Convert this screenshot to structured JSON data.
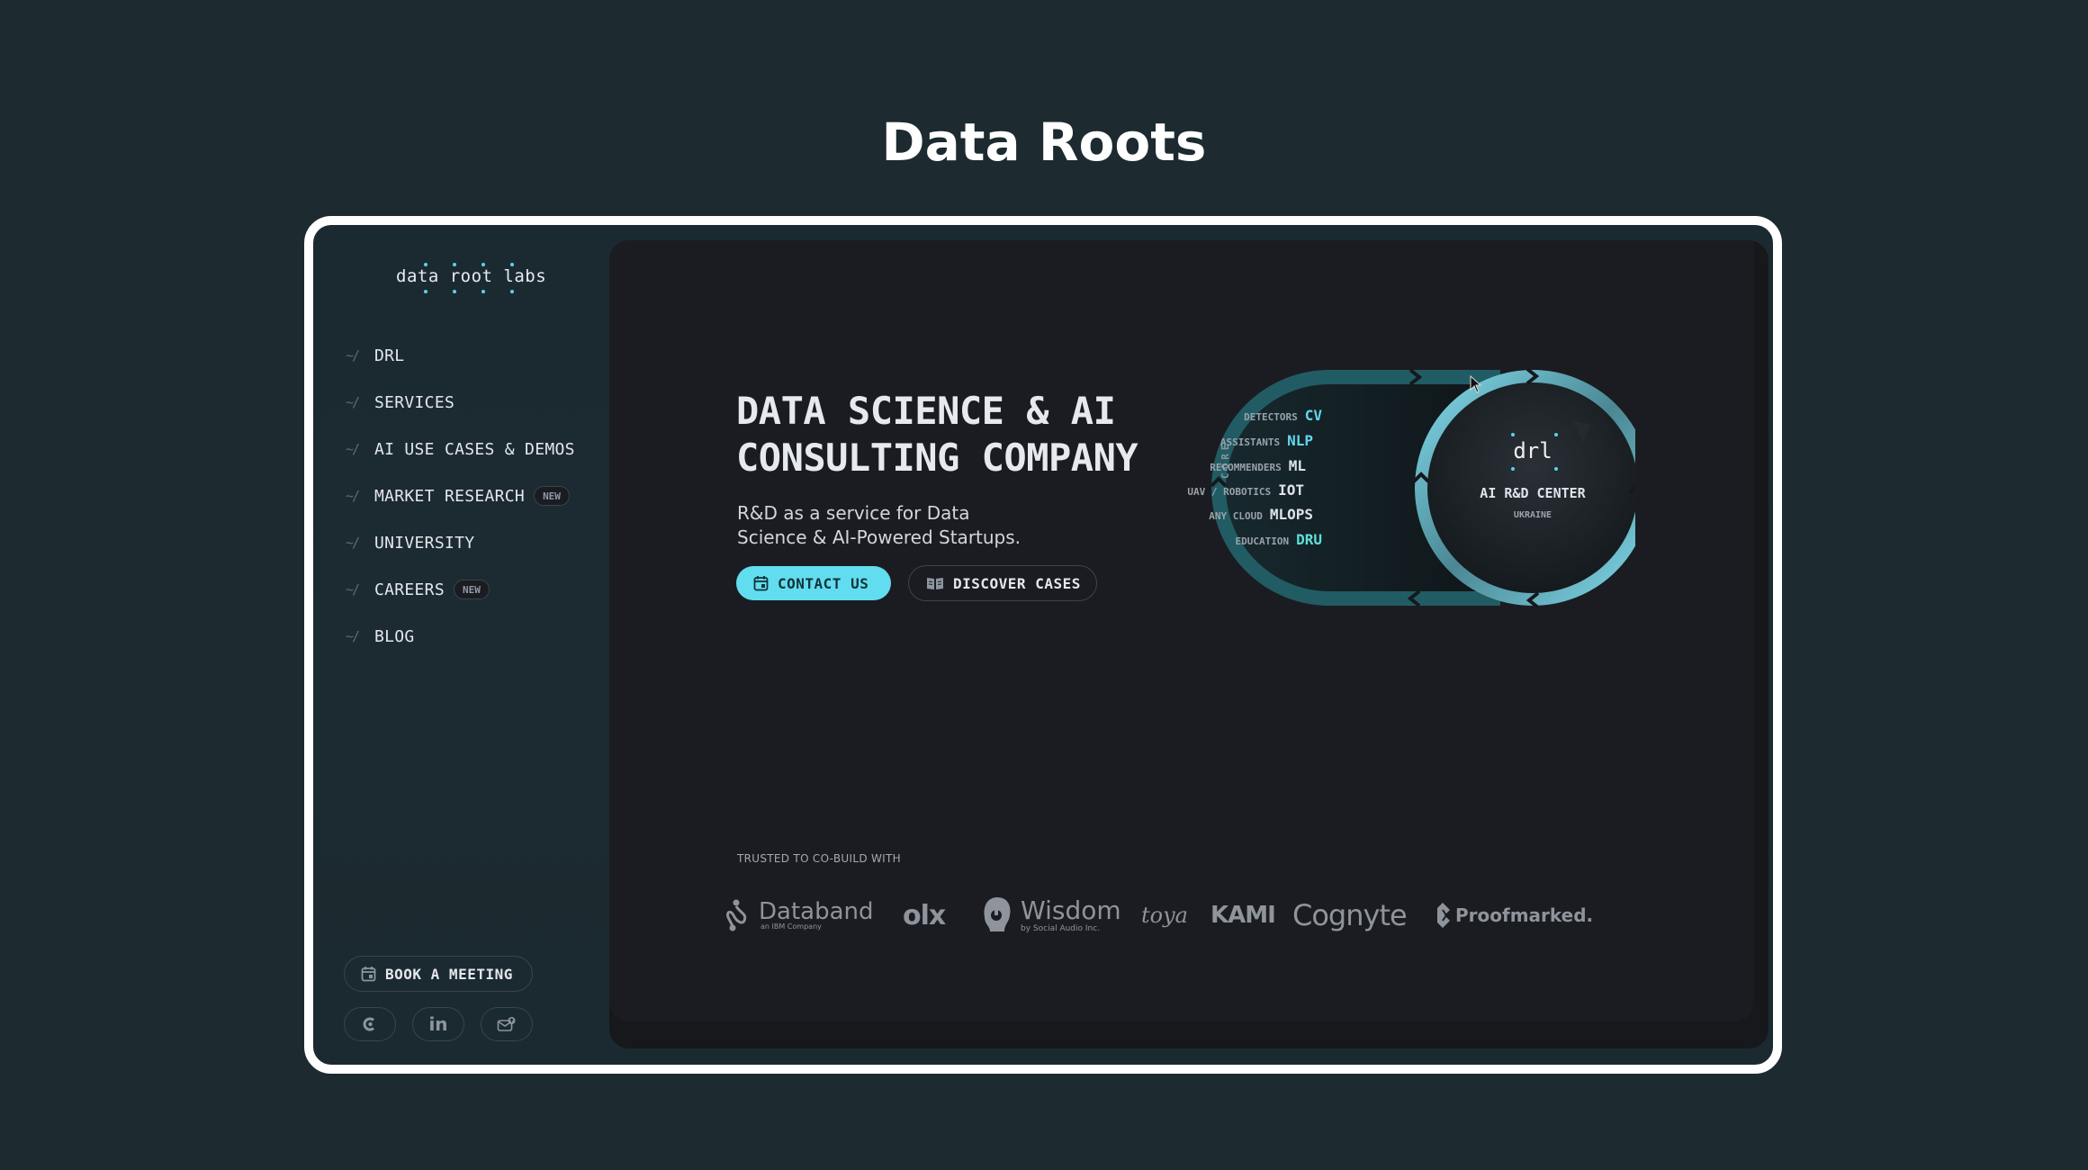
{
  "page": {
    "title": "Data Roots"
  },
  "sidebar": {
    "logo": {
      "text": "data root labs"
    },
    "nav_prefix": "~/",
    "items": [
      {
        "label": "DRL",
        "badge": null
      },
      {
        "label": "SERVICES",
        "badge": null
      },
      {
        "label": "AI USE CASES & DEMOS",
        "badge": null
      },
      {
        "label": "MARKET RESEARCH",
        "badge": "NEW"
      },
      {
        "label": "UNIVERSITY",
        "badge": null
      },
      {
        "label": "CAREERS",
        "badge": "NEW"
      },
      {
        "label": "BLOG",
        "badge": null
      }
    ],
    "book_button": {
      "label": "BOOK A MEETING",
      "icon": "calendar-icon"
    },
    "social": [
      {
        "name": "clutch",
        "icon": "clutch-icon"
      },
      {
        "name": "linkedin",
        "icon": "linkedin-icon",
        "text": "in"
      },
      {
        "name": "email",
        "icon": "mail-icon"
      }
    ]
  },
  "hero": {
    "headline": [
      "DATA SCIENCE & AI",
      "CONSULTING COMPANY"
    ],
    "subtitle": [
      "R&D as a service for Data",
      "Science & AI-Powered Startups."
    ],
    "contact_button": {
      "label": "CONTACT US",
      "icon": "calendar-icon"
    },
    "discover_button": {
      "label": "DISCOVER CASES",
      "icon": "book-icon"
    }
  },
  "diagram": {
    "core_label": "CORE",
    "rows": [
      {
        "category": "DETECTORS",
        "abbr": "CV",
        "color": "#62d6ee"
      },
      {
        "category": "ASSISTANTS",
        "abbr": "NLP",
        "color": "#62d6ee"
      },
      {
        "category": "RECOMMENDERS",
        "abbr": "ML",
        "color": "#dfe3ea"
      },
      {
        "category": "UAV / ROBOTICS",
        "abbr": "IOT",
        "color": "#dfe3ea"
      },
      {
        "category": "ANY CLOUD",
        "abbr": "MLOPS",
        "color": "#dfe3ea"
      },
      {
        "category": "EDUCATION",
        "abbr": "DRU",
        "color": "#5ee0d8"
      }
    ],
    "center": {
      "logo": "drl",
      "title": "AI R&D CENTER",
      "subtitle": "UKRAINE"
    }
  },
  "trusted": {
    "label": "TRUSTED TO CO-BUILD WITH",
    "logos": [
      {
        "name": "Databand",
        "sub": "an IBM Company"
      },
      {
        "name": "olx"
      },
      {
        "name": "Wisdom",
        "sub": "by Social Audio Inc."
      },
      {
        "name": "toya"
      },
      {
        "name": "KAMI"
      },
      {
        "name": "Cognyte"
      },
      {
        "name": "Proofmarked."
      }
    ]
  },
  "colors": {
    "accent": "#62ddf0",
    "background": "#1d2a30",
    "panel": "#1b1c21",
    "ring_dark": "#1f5e66",
    "ring_light": "#7fd6e8"
  }
}
